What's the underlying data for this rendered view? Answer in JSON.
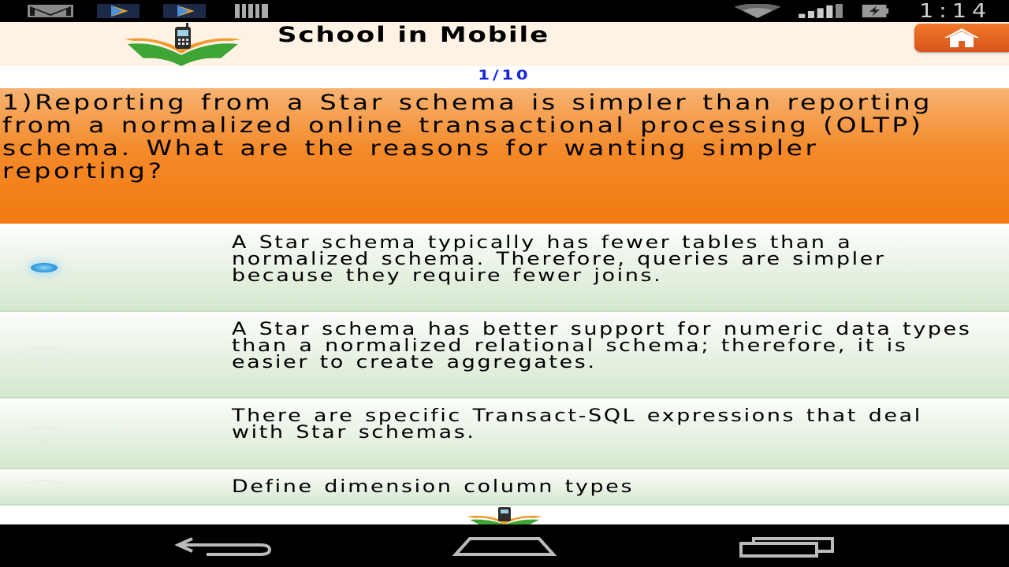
{
  "status_bar": {
    "time": "1:14",
    "icons": [
      "gmail-icon",
      "play-store-icon",
      "play-store-icon",
      "barcode-icon",
      "wifi-icon",
      "signal-icon",
      "battery-icon"
    ]
  },
  "header": {
    "title": "School in Mobile",
    "logo": "school-in-mobile-logo",
    "home_icon": "home-icon"
  },
  "progress": {
    "counter": "1/10"
  },
  "question": {
    "text": "1)Reporting from a Star schema is simpler than reporting from a normalized online transactional processing (OLTP) schema. What are the reasons for wanting simpler reporting?"
  },
  "options": [
    {
      "text": "A Star schema typically has fewer tables than a normalized schema. Therefore, queries are simpler because they require fewer joins.",
      "selected": true
    },
    {
      "text": "A Star schema has better support for numeric data types than a normalized relational schema; therefore, it is easier to create aggregates.",
      "selected": false
    },
    {
      "text": "There are specific Transact-SQL expressions that deal with Star schemas.",
      "selected": false
    },
    {
      "text": "Define dimension column types",
      "selected": false
    }
  ],
  "nav_bar": {
    "icons": [
      "back-icon",
      "home-nav-icon",
      "recents-icon"
    ]
  },
  "colors": {
    "question_bg": "#f48a2a",
    "option_bg": "#e7f1e3",
    "counter": "#1a27d6",
    "home_button": "#e8641f"
  }
}
